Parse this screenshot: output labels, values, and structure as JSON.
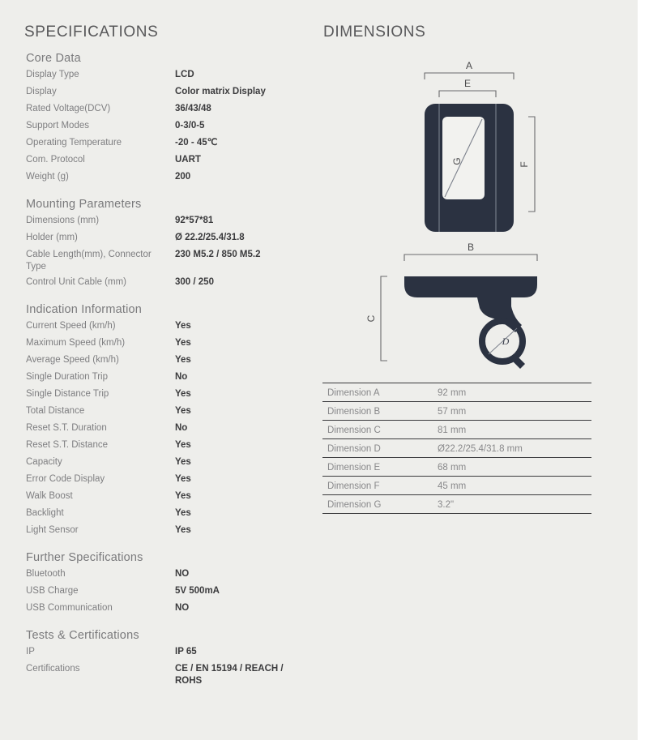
{
  "colors": {
    "background": "#eeeeeb",
    "device_dark": "#2b3241",
    "title": "#58585a",
    "label": "#7e7e80",
    "value": "#3b3b3d",
    "rule": "#3a3a3c"
  },
  "specifications": {
    "heading": "SPECIFICATIONS",
    "groups": [
      {
        "title": "Core Data",
        "rows": [
          {
            "label": "Display Type",
            "value": "LCD"
          },
          {
            "label": "Display",
            "value": "Color matrix Display"
          },
          {
            "label": "Rated Voltage(DCV)",
            "value": "36/43/48"
          },
          {
            "label": "Support Modes",
            "value": "0-3/0-5"
          },
          {
            "label": "Operating Temperature",
            "value": "-20 - 45℃"
          },
          {
            "label": "Com. Protocol",
            "value": "UART"
          },
          {
            "label": "Weight (g)",
            "value": "200"
          }
        ]
      },
      {
        "title": "Mounting Parameters",
        "rows": [
          {
            "label": "Dimensions (mm)",
            "value": "92*57*81"
          },
          {
            "label": "Holder (mm)",
            "value": "Ø 22.2/25.4/31.8"
          },
          {
            "label": "Cable Length(mm), Connector Type",
            "value": "230 M5.2 / 850 M5.2"
          },
          {
            "label": "Control Unit Cable (mm)",
            "value": "300 / 250"
          }
        ]
      },
      {
        "title": "Indication Information",
        "rows": [
          {
            "label": "Current Speed (km/h)",
            "value": "Yes"
          },
          {
            "label": "Maximum Speed (km/h)",
            "value": "Yes"
          },
          {
            "label": "Average Speed (km/h)",
            "value": "Yes"
          },
          {
            "label": "Single Duration Trip",
            "value": "No"
          },
          {
            "label": "Single Distance Trip",
            "value": "Yes"
          },
          {
            "label": "Total Distance",
            "value": "Yes"
          },
          {
            "label": "Reset S.T. Duration",
            "value": "No"
          },
          {
            "label": "Reset S.T. Distance",
            "value": "Yes"
          },
          {
            "label": "Capacity",
            "value": "Yes"
          },
          {
            "label": "Error Code Display",
            "value": "Yes"
          },
          {
            "label": "Walk Boost",
            "value": "Yes"
          },
          {
            "label": "Backlight",
            "value": "Yes"
          },
          {
            "label": "Light Sensor",
            "value": "Yes"
          }
        ]
      },
      {
        "title": "Further Specifications",
        "rows": [
          {
            "label": "Bluetooth",
            "value": "NO"
          },
          {
            "label": "USB Charge",
            "value": "5V 500mA"
          },
          {
            "label": "USB Communication",
            "value": "NO"
          }
        ]
      },
      {
        "title": "Tests & Certifications",
        "rows": [
          {
            "label": "IP",
            "value": "IP 65"
          },
          {
            "label": "Certifications",
            "value": "CE / EN 15194 / REACH / ROHS"
          }
        ]
      }
    ]
  },
  "dimensions": {
    "heading": "DIMENSIONS",
    "drawing_labels": {
      "a": "A",
      "b": "B",
      "c": "C",
      "d": "D",
      "e": "E",
      "f": "F",
      "g": "G"
    },
    "table": [
      {
        "key": "Dimension A",
        "value": "92 mm"
      },
      {
        "key": "Dimension B",
        "value": "57 mm"
      },
      {
        "key": "Dimension C",
        "value": "81 mm"
      },
      {
        "key": "Dimension D",
        "value": "Ø22.2/25.4/31.8 mm"
      },
      {
        "key": "Dimension E",
        "value": "68 mm"
      },
      {
        "key": "Dimension F",
        "value": "45 mm"
      },
      {
        "key": "Dimension G",
        "value": "3.2\""
      }
    ]
  }
}
